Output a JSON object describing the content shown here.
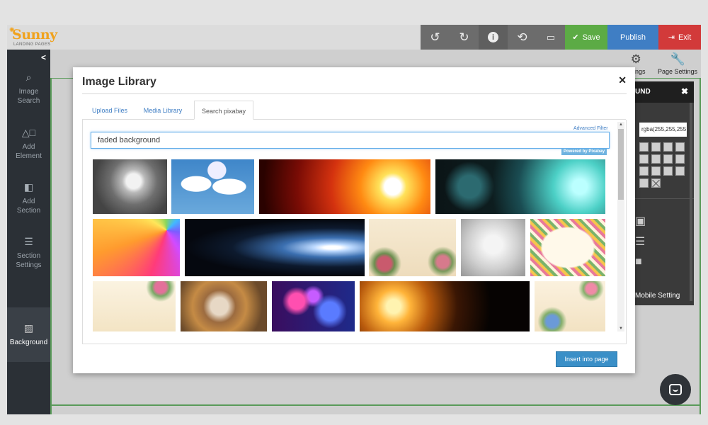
{
  "brand": {
    "name": "Sunny",
    "tagline": "LANDING PAGES",
    "color": "#f0a21d"
  },
  "toolbar": {
    "undo_icon": "undo-icon",
    "redo_icon": "redo-icon",
    "info_icon": "info-icon",
    "history_icon": "history-icon",
    "device_icon": "device-preview-icon",
    "save_label": "Save",
    "publish_label": "Publish",
    "exit_label": "Exit",
    "save_color": "#5cab45",
    "publish_color": "#3f7ec4",
    "exit_color": "#d23a3a"
  },
  "sidebar": {
    "items": [
      {
        "label_1": "Image",
        "label_2": "Search",
        "icon": "search-icon"
      },
      {
        "label_1": "Add",
        "label_2": "Element",
        "icon": "shapes-icon"
      },
      {
        "label_1": "Add",
        "label_2": "Section",
        "icon": "section-icon"
      },
      {
        "label_1": "Section",
        "label_2": "Settings",
        "icon": "sliders-icon"
      },
      {
        "label_1": "Background",
        "label_2": "",
        "icon": "texture-icon",
        "active": true
      }
    ]
  },
  "canvas": {
    "settings_label": "ettings",
    "page_settings_label": "Page Settings"
  },
  "right_panel": {
    "title": "UND",
    "rgba_value": "rgba(255,255,255",
    "mobile_label": "Mobile Setting"
  },
  "modal": {
    "title": "Image Library",
    "tabs": [
      "Upload Files",
      "Media Library",
      "Search pixabay"
    ],
    "active_tab": "Search pixabay",
    "advanced_filter": "Advanced Filter",
    "search_value": "faded background",
    "powered_by": "Powered by Pixabay",
    "insert_label": "Insert into page",
    "images": [
      "dandelion",
      "world map clouds",
      "orange sun flare",
      "teal lens flare",
      "rainbow rays",
      "blue light flare",
      "vintage flowers",
      "grey texture",
      "floral frame",
      "floral paper",
      "wooden hearts",
      "bokeh pink blue",
      "orange sun dark",
      "watercolor flowers"
    ]
  }
}
